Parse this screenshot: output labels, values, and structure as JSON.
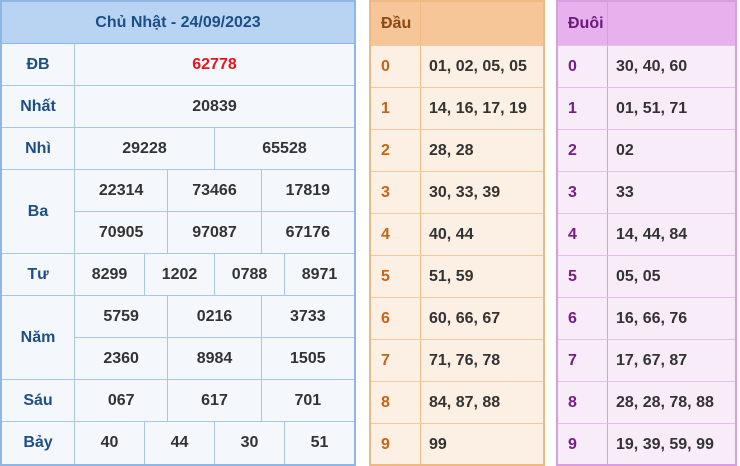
{
  "results": {
    "title": "Chủ Nhật - 24/09/2023",
    "rows": [
      {
        "label": "ĐB",
        "lines": [
          [
            "62778"
          ]
        ]
      },
      {
        "label": "Nhất",
        "lines": [
          [
            "20839"
          ]
        ]
      },
      {
        "label": "Nhì",
        "lines": [
          [
            "29228",
            "65528"
          ]
        ]
      },
      {
        "label": "Ba",
        "lines": [
          [
            "22314",
            "73466",
            "17819"
          ],
          [
            "70905",
            "97087",
            "67176"
          ]
        ]
      },
      {
        "label": "Tư",
        "lines": [
          [
            "8299",
            "1202",
            "0788",
            "8971"
          ]
        ]
      },
      {
        "label": "Năm",
        "lines": [
          [
            "5759",
            "0216",
            "3733"
          ],
          [
            "2360",
            "8984",
            "1505"
          ]
        ]
      },
      {
        "label": "Sáu",
        "lines": [
          [
            "067",
            "617",
            "701"
          ]
        ]
      },
      {
        "label": "Bảy",
        "lines": [
          [
            "40",
            "44",
            "30",
            "51"
          ]
        ]
      }
    ]
  },
  "dau": {
    "header": "Đầu",
    "rows": [
      {
        "digit": "0",
        "values": "01, 02, 05, 05"
      },
      {
        "digit": "1",
        "values": "14, 16, 17, 19"
      },
      {
        "digit": "2",
        "values": "28, 28"
      },
      {
        "digit": "3",
        "values": "30, 33, 39"
      },
      {
        "digit": "4",
        "values": "40, 44"
      },
      {
        "digit": "5",
        "values": "51, 59"
      },
      {
        "digit": "6",
        "values": "60, 66, 67"
      },
      {
        "digit": "7",
        "values": "71, 76, 78"
      },
      {
        "digit": "8",
        "values": "84, 87, 88"
      },
      {
        "digit": "9",
        "values": "99"
      }
    ]
  },
  "duoi": {
    "header": "Đuôi",
    "rows": [
      {
        "digit": "0",
        "values": "30, 40, 60"
      },
      {
        "digit": "1",
        "values": "01, 51, 71"
      },
      {
        "digit": "2",
        "values": "02"
      },
      {
        "digit": "3",
        "values": "33"
      },
      {
        "digit": "4",
        "values": "14, 44, 84"
      },
      {
        "digit": "5",
        "values": "05, 05"
      },
      {
        "digit": "6",
        "values": "16, 66, 76"
      },
      {
        "digit": "7",
        "values": "17, 67, 87"
      },
      {
        "digit": "8",
        "values": "28, 28, 78, 88"
      },
      {
        "digit": "9",
        "values": "19, 39, 59, 99"
      }
    ]
  }
}
